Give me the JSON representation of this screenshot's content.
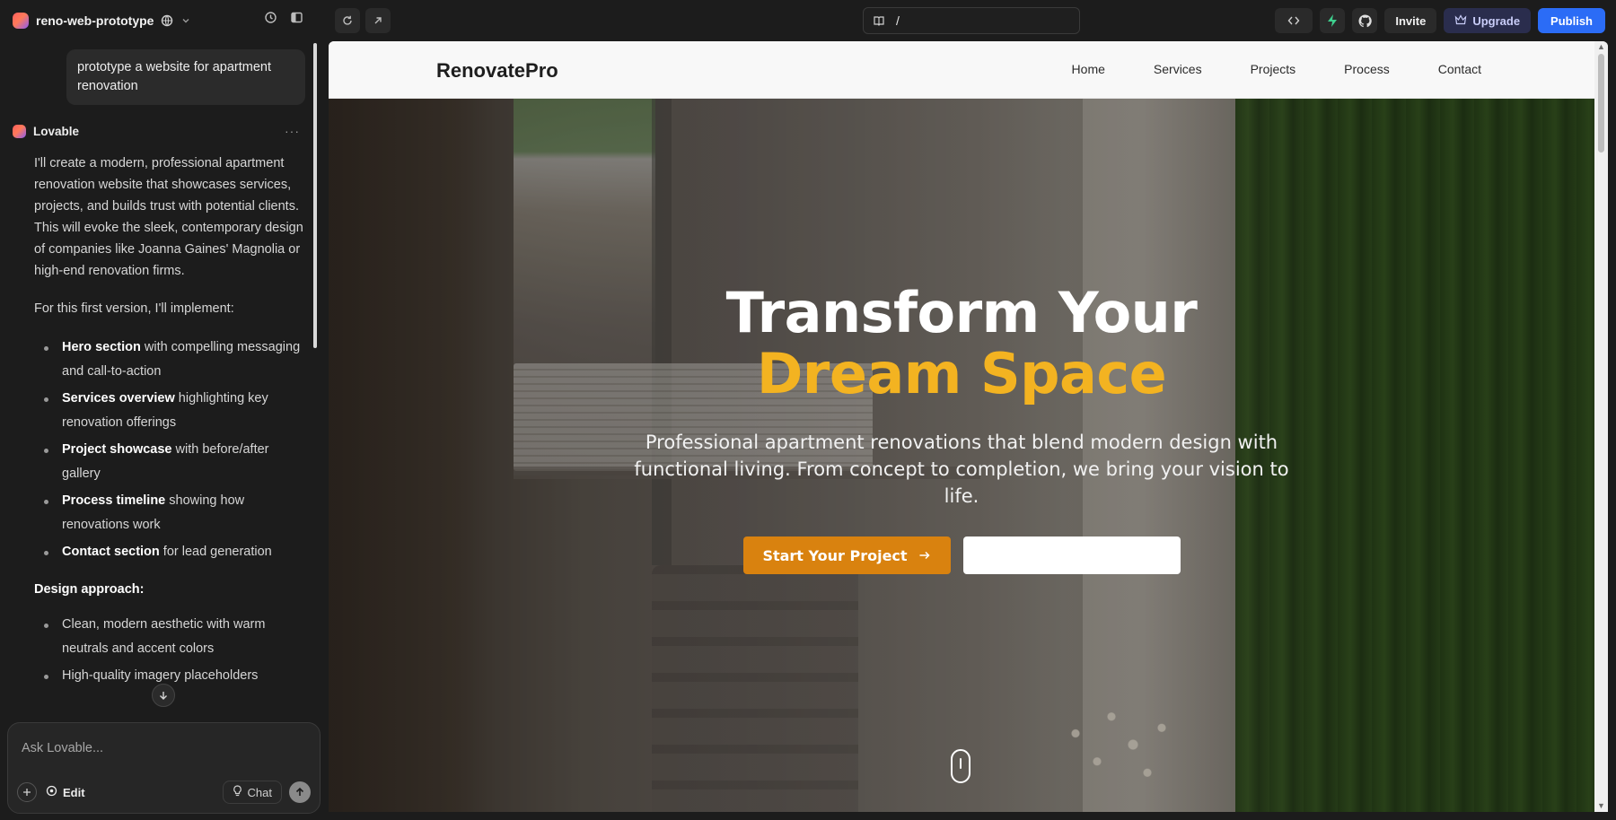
{
  "topbar": {
    "project_name": "reno-web-prototype",
    "url_path": "/",
    "invite_label": "Invite",
    "upgrade_label": "Upgrade",
    "publish_label": "Publish"
  },
  "chat": {
    "user_message": "prototype a website for apartment renovation",
    "assistant_name": "Lovable",
    "intro": "I'll create a modern, professional apartment renovation website that showcases services, projects, and builds trust with potential clients. This will evoke the sleek, contemporary design of companies like Joanna Gaines' Magnolia or high-end renovation firms.",
    "plan_intro": "For this first version, I'll implement:",
    "features": [
      {
        "bold": "Hero section",
        "rest": " with compelling messaging and call-to-action"
      },
      {
        "bold": "Services overview",
        "rest": " highlighting key renovation offerings"
      },
      {
        "bold": "Project showcase",
        "rest": " with before/after gallery"
      },
      {
        "bold": "Process timeline",
        "rest": " showing how renovations work"
      },
      {
        "bold": "Contact section",
        "rest": " for lead generation"
      }
    ],
    "design_heading": "Design approach:",
    "design_items": [
      "Clean, modern aesthetic with warm neutrals and accent colors",
      "High-quality imagery placeholders"
    ],
    "composer_placeholder": "Ask Lovable...",
    "edit_label": "Edit",
    "chat_label": "Chat"
  },
  "site": {
    "brand": "RenovatePro",
    "nav": [
      "Home",
      "Services",
      "Projects",
      "Process",
      "Contact"
    ],
    "hero_title_line1": "Transform Your",
    "hero_title_line2": "Dream Space",
    "hero_subtitle": "Professional apartment renovations that blend modern design with functional living. From concept to completion, we bring your vision to life.",
    "primary_cta": "Start Your Project"
  },
  "colors": {
    "accent": "#f3b321",
    "cta": "#d9820f",
    "publish": "#2b6cf6"
  }
}
